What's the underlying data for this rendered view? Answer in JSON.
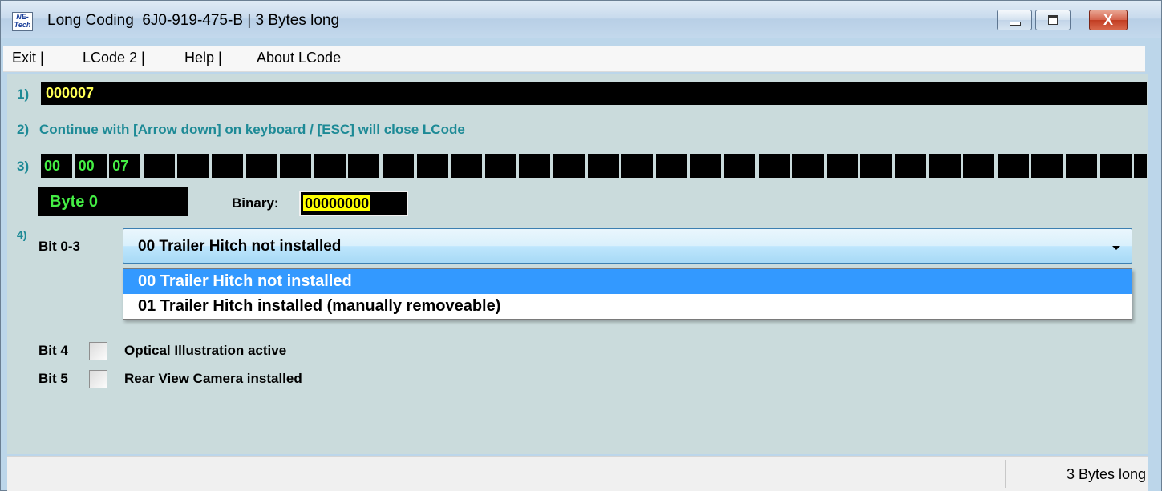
{
  "window": {
    "icon_text": "NE-Tech",
    "title": "Long Coding  6J0-919-475-B | 3 Bytes long",
    "minimize": "minimize",
    "maximize": "maximize",
    "close": "X"
  },
  "menu": [
    {
      "label": "Exit |"
    },
    {
      "label": "LCode 2 |"
    },
    {
      "label": "Help |"
    },
    {
      "label": "About LCode"
    }
  ],
  "steps": {
    "s1": "1)",
    "s2": "2)",
    "s3": "3)",
    "s4": "4)"
  },
  "long_code": "000007",
  "instruction": "Continue with [Arrow down] on keyboard / [ESC] will close LCode",
  "bytes": [
    "00",
    "00",
    "07",
    "",
    "",
    "",
    "",
    "",
    "",
    "",
    "",
    "",
    "",
    "",
    "",
    "",
    "",
    "",
    "",
    "",
    "",
    "",
    "",
    "",
    "",
    "",
    "",
    "",
    "",
    "",
    "",
    "",
    "",
    "",
    ""
  ],
  "byte_label": "Byte 0",
  "binary": {
    "label": "Binary:",
    "value": "00000000"
  },
  "bit_0_3": {
    "label": "Bit 0-3",
    "selected": "00 Trailer Hitch not installed",
    "options": [
      "00 Trailer Hitch not installed",
      "01 Trailer Hitch installed (manually removeable)"
    ]
  },
  "bit4": {
    "label": "Bit 4",
    "text": "Optical Illustration active",
    "checked": false
  },
  "bit5": {
    "label": "Bit 5",
    "text": "Rear View Camera installed",
    "checked": false
  },
  "status": {
    "right": "3 Bytes long"
  },
  "colors": {
    "accent_teal": "#1d8a96",
    "code_green": "#44ee44",
    "code_yellow": "#ffff55",
    "selection_blue": "#3399ff"
  }
}
